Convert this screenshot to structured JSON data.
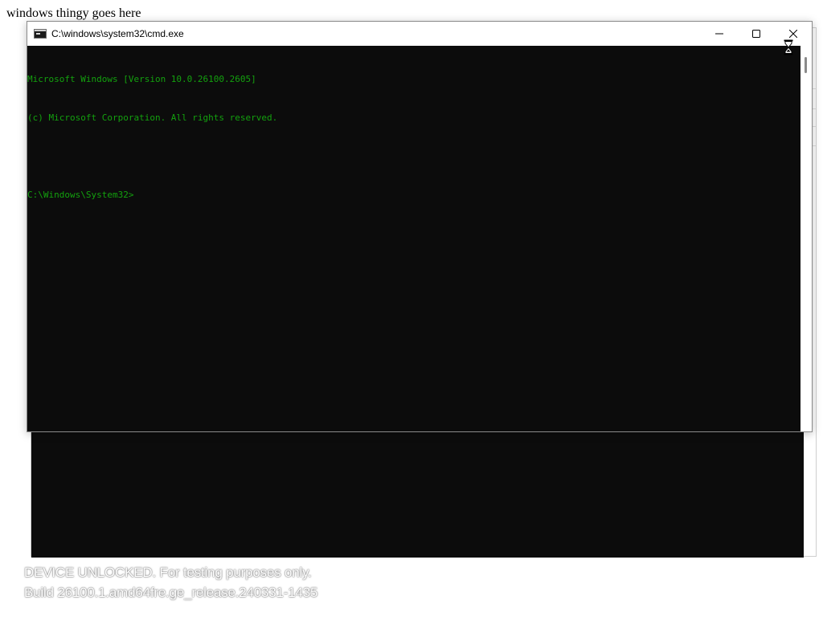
{
  "page": {
    "heading": "windows thingy goes here"
  },
  "cmd_window": {
    "title": "C:\\windows\\system32\\cmd.exe",
    "icon": "console-icon",
    "controls": {
      "minimize": "minimize-icon",
      "maximize": "maximize-icon",
      "close": "close-icon"
    },
    "console_lines": [
      "Microsoft Windows [Version 10.0.26100.2605]",
      "(c) Microsoft Corporation. All rights reserved.",
      "",
      "C:\\Windows\\System32>"
    ],
    "colors": {
      "console_text": "#13a10e",
      "console_background": "#0c0c0c"
    }
  },
  "cursor": {
    "icon": "hourglass-busy-cursor-icon"
  },
  "watermark": {
    "line1": "DEVICE UNLOCKED. For testing purposes only.",
    "line2": "Build 26100.1.amd64fre.ge_release.240331-1435"
  }
}
